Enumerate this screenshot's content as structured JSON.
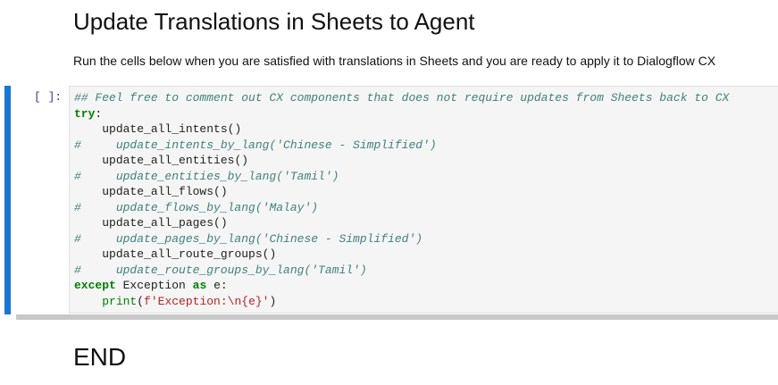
{
  "markdown": {
    "title": "Update Translations in Sheets to Agent",
    "description": "Run the cells below when you are satisfied with translations in Sheets and you are ready to apply it to Dialogflow CX"
  },
  "cell": {
    "prompt": "[ ]:",
    "lines": [
      "## Feel free to comment out CX components that does not require updates from Sheets back to CX",
      "try",
      "update_all_intents()",
      "update_intents_by_lang('Chinese - Simplified')",
      "update_all_entities()",
      "update_entities_by_lang('Tamil')",
      "update_all_flows()",
      "update_flows_by_lang('Malay')",
      "update_all_pages()",
      "update_pages_by_lang('Chinese - Simplified')",
      "update_all_route_groups()",
      "update_route_groups_by_lang('Tamil')",
      "except",
      "Exception",
      "as",
      "e:",
      "print",
      "f'Exception:\\n{e}'"
    ]
  },
  "end": {
    "title": "END"
  },
  "colors": {
    "accent": "#1976d2",
    "comment": "#408080",
    "keyword": "#008000",
    "string": "#ba2121"
  }
}
